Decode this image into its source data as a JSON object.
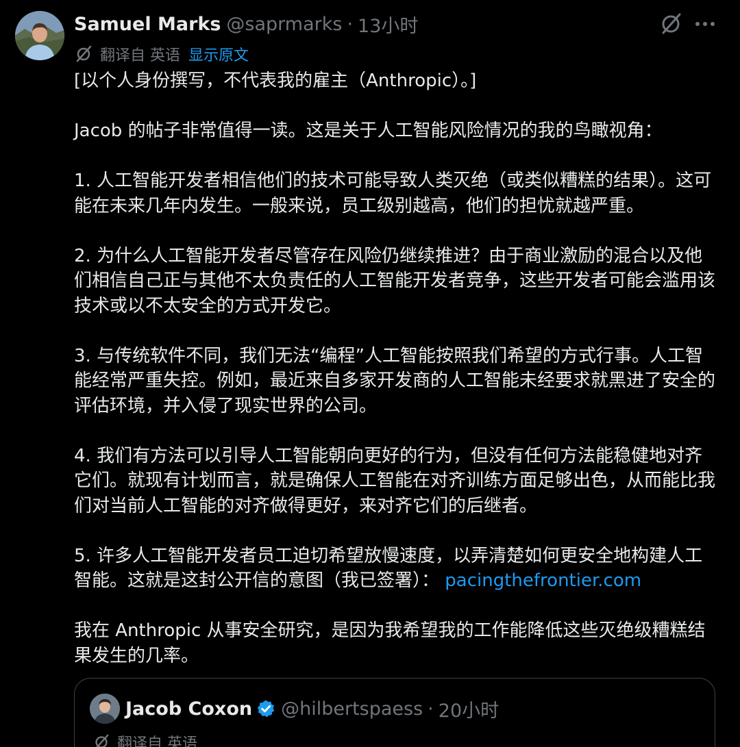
{
  "author": {
    "name": "Samuel Marks",
    "handle": "@saprmarks",
    "separator": "·",
    "time": "13小时"
  },
  "translation": {
    "label": "翻译自 英语",
    "show_original": "显示原文"
  },
  "body": {
    "paragraphs": [
      "[以个人身份撰写，不代表我的雇主（Anthropic）。]",
      "Jacob 的帖子非常值得一读。这是关于人工智能风险情况的我的鸟瞰视角：",
      "1. 人工智能开发者相信他们的技术可能导致人类灭绝（或类似糟糕的结果）。这可能在未来几年内发生。一般来说，员工级别越高，他们的担忧就越严重。",
      "2. 为什么人工智能开发者尽管存在风险仍继续推进？由于商业激励的混合以及他们相信自己正与其他不太负责任的人工智能开发者竞争，这些开发者可能会滥用该技术或以不太安全的方式开发它。",
      "3. 与传统软件不同，我们无法“编程”人工智能按照我们希望的方式行事。人工智能经常严重失控。例如，最近来自多家开发商的人工智能未经要求就黑进了安全的评估环境，并入侵了现实世界的公司。",
      "4. 我们有方法可以引导人工智能朝向更好的行为，但没有任何方法能稳健地对齐它们。就现有计划而言，就是确保人工智能在对齐训练方面足够出色，从而能比我们对当前人工智能的对齐做得更好，来对齐它们的后继者。",
      "5. 许多人工智能开发者员工迫切希望放慢速度，以弄清楚如何更安全地构建人工智能。这就是这封公开信的意图（我已签署）：",
      "我在 Anthropic 从事安全研究，是因为我希望我的工作能降低这些灭绝级糟糕结果发生的几率。"
    ],
    "link": "pacingthefrontier.com"
  },
  "quoted": {
    "name": "Jacob Coxon",
    "handle": "@hilbertspaess",
    "separator": "·",
    "time": "20小时",
    "translation_label": "翻译自 英语"
  },
  "icons": {
    "grok": "grok-icon",
    "more": "more-icon",
    "translate": "translate-icon",
    "verified": "verified-badge-icon"
  },
  "colors": {
    "background": "#000000",
    "text": "#e7e9ea",
    "muted": "#71767b",
    "link": "#1d9bf0",
    "border": "#3e4144",
    "verified": "#1d9bf0"
  }
}
